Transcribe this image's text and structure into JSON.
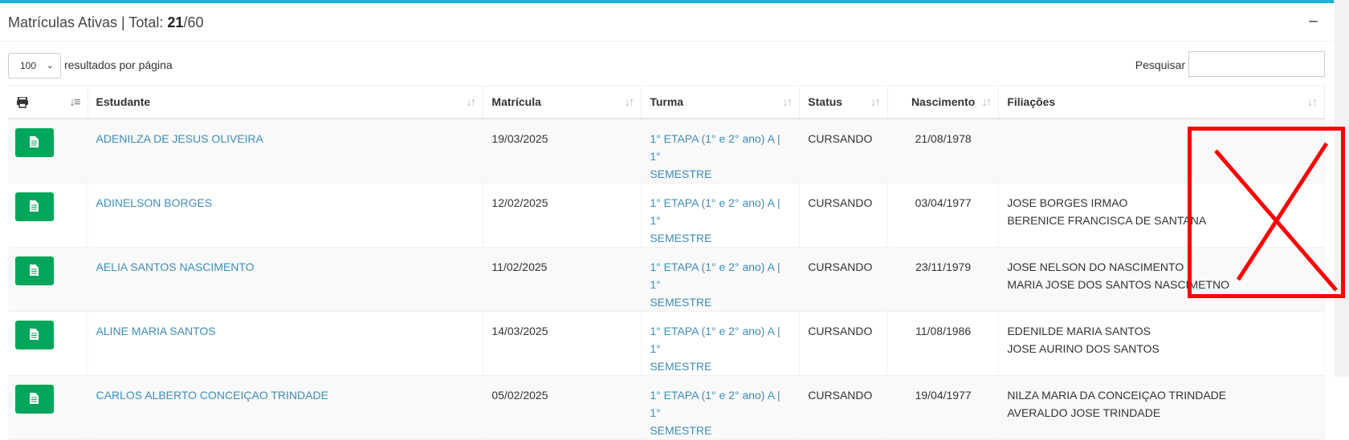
{
  "header": {
    "title_prefix": "Matrículas Ativas | Total: ",
    "total_active": "21",
    "total_suffix": "/60",
    "collapse_symbol": "−"
  },
  "controls": {
    "page_length": "100",
    "page_length_label": "resultados por página",
    "search_label": "Pesquisar",
    "search_value": ""
  },
  "columns": {
    "print": "print-icon",
    "estudante": "Estudante",
    "matricula": "Matrícula",
    "turma": "Turma",
    "status": "Status",
    "nascimento": "Nascimento",
    "filiacoes": "Filiações"
  },
  "rows": [
    {
      "estudante": "ADENILZA DE JESUS OLIVEIRA",
      "matricula": "19/03/2025",
      "turma_l1": "1° ETAPA (1° e 2° ano) A | 1°",
      "turma_l2": "SEMESTRE",
      "status": "CURSANDO",
      "nascimento": "21/08/1978",
      "filiacao1": "",
      "filiacao2": ""
    },
    {
      "estudante": "ADINELSON BORGES",
      "matricula": "12/02/2025",
      "turma_l1": "1° ETAPA (1° e 2° ano) A | 1°",
      "turma_l2": "SEMESTRE",
      "status": "CURSANDO",
      "nascimento": "03/04/1977",
      "filiacao1": "JOSE BORGES IRMAO",
      "filiacao2": "BERENICE FRANCISCA DE SANTANA"
    },
    {
      "estudante": "AELIA SANTOS NASCIMENTO",
      "matricula": "11/02/2025",
      "turma_l1": "1° ETAPA (1° e 2° ano) A | 1°",
      "turma_l2": "SEMESTRE",
      "status": "CURSANDO",
      "nascimento": "23/11/1979",
      "filiacao1": "JOSE NELSON DO NASCIMENTO",
      "filiacao2": "MARIA JOSE DOS SANTOS NASCIMETNO"
    },
    {
      "estudante": "ALINE MARIA SANTOS",
      "matricula": "14/03/2025",
      "turma_l1": "1° ETAPA (1° e 2° ano) A | 1°",
      "turma_l2": "SEMESTRE",
      "status": "CURSANDO",
      "nascimento": "11/08/1986",
      "filiacao1": "EDENILDE MARIA SANTOS",
      "filiacao2": "JOSE AURINO DOS SANTOS"
    },
    {
      "estudante": "CARLOS ALBERTO CONCEIÇAO TRINDADE",
      "matricula": "05/02/2025",
      "turma_l1": "1° ETAPA (1° e 2° ano) A | 1°",
      "turma_l2": "SEMESTRE",
      "status": "CURSANDO",
      "nascimento": "19/04/1977",
      "filiacao1": "NILZA MARIA DA CONCEIÇAO TRINDADE",
      "filiacao2": "AVERALDO JOSE TRINDADE"
    }
  ],
  "colors": {
    "accent": "#1ab2d6",
    "link": "#3c8dbc",
    "button": "#00a65a",
    "annotation": "#ff0000"
  }
}
